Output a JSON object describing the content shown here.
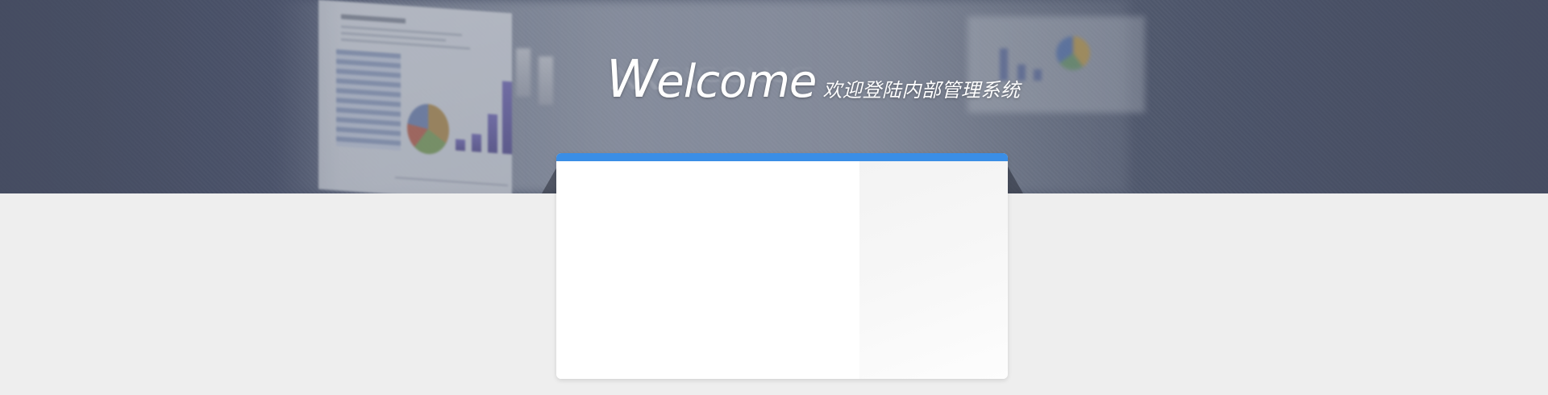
{
  "header": {
    "welcome_word": "Welcome",
    "welcome_cap": "W",
    "welcome_rest": "elcome",
    "subtitle": "欢迎登陆内部管理系统"
  },
  "colors": {
    "banner": "#525972",
    "accent_bar": "#3a8ee6",
    "page_background": "#eeeeee",
    "card_background": "#ffffff"
  }
}
